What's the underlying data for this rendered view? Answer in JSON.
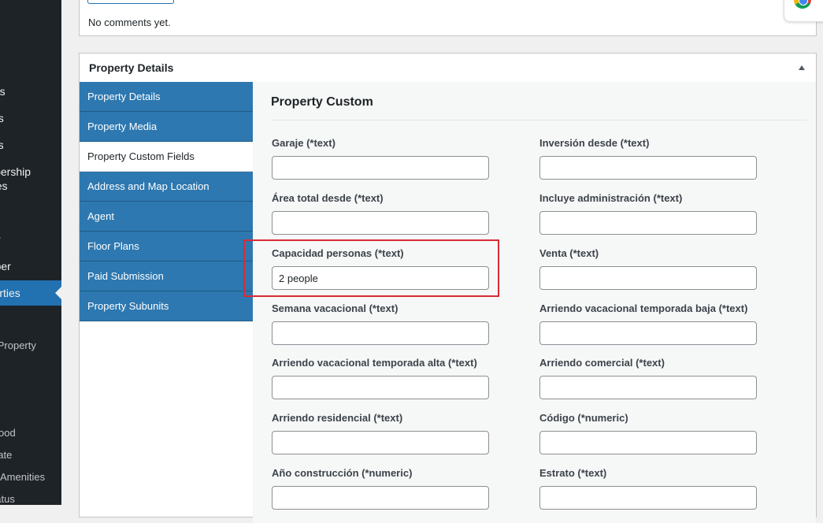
{
  "sidebar": {
    "items": [
      {
        "label": "Comments"
      },
      {
        "label": "Pages"
      },
      {
        "label": "Profiles"
      },
      {
        "label": "Membership"
      },
      {
        "label": "Packages"
      },
      {
        "label": "Weekly"
      },
      {
        "label": "Developer"
      },
      {
        "label": "Properties"
      }
    ],
    "subitems": [
      {
        "label": "Add Property"
      },
      {
        "label": "Neighborhood"
      },
      {
        "label": "State"
      },
      {
        "label": "Amenities"
      },
      {
        "label": "Status"
      }
    ]
  },
  "comments": {
    "text": "No comments yet."
  },
  "postbox": {
    "title": "Property Details",
    "toggle_icon": "triangle-up-icon"
  },
  "tabs": [
    {
      "label": "Property Details"
    },
    {
      "label": "Property Media"
    },
    {
      "label": "Property Custom Fields"
    },
    {
      "label": "Address and Map Location"
    },
    {
      "label": "Agent"
    },
    {
      "label": "Floor Plans"
    },
    {
      "label": "Paid Submission"
    },
    {
      "label": "Property Subunits"
    }
  ],
  "panel": {
    "title": "Property Custom"
  },
  "fields": [
    {
      "label": "Garaje (*text)",
      "value": ""
    },
    {
      "label": "Inversión desde (*text)",
      "value": ""
    },
    {
      "label": "Área total desde (*text)",
      "value": ""
    },
    {
      "label": "Incluye administración (*text)",
      "value": ""
    },
    {
      "label": "Capacidad personas (*text)",
      "value": "2 people"
    },
    {
      "label": "Venta (*text)",
      "value": ""
    },
    {
      "label": "Semana vacacional (*text)",
      "value": ""
    },
    {
      "label": "Arriendo vacacional temporada baja (*text)",
      "value": ""
    },
    {
      "label": "Arriendo vacacional temporada alta (*text)",
      "value": ""
    },
    {
      "label": "Arriendo comercial (*text)",
      "value": ""
    },
    {
      "label": "Arriendo residencial (*text)",
      "value": ""
    },
    {
      "label": "Código (*numeric)",
      "value": ""
    },
    {
      "label": "Año construcción (*numeric)",
      "value": ""
    },
    {
      "label": "Estrato (*text)",
      "value": ""
    }
  ],
  "colors": {
    "highlight": "#d92b35",
    "tab_bg": "#2d78b0",
    "sidebar_bg": "#1d2327",
    "sidebar_active": "#2271b1"
  }
}
